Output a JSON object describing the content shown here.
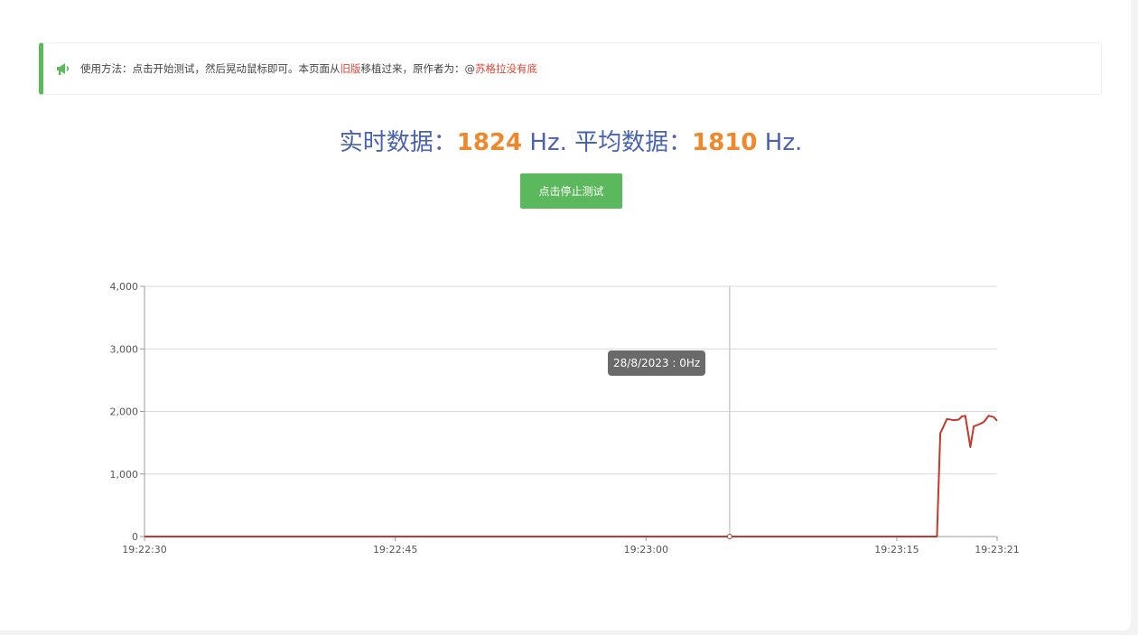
{
  "notice": {
    "icon": "megaphone-icon",
    "prefix": "使用方法：点击开始测试，然后晃动鼠标即可。本页面从",
    "link_old": "旧版",
    "middle": "移植过来，原作者为：@",
    "author": "苏格拉没有底",
    "accent_color": "#5cb85c",
    "link_color": "#e24333"
  },
  "stats": {
    "realtime_label": "实时数据：",
    "realtime_value": "1824",
    "realtime_unit": "Hz.",
    "average_label": "平均数据：",
    "average_value": "1810",
    "average_unit": "Hz."
  },
  "stop_button": {
    "label": "点击停止测试"
  },
  "tooltip": {
    "text": "28/8/2023 : 0Hz"
  },
  "chart_data": {
    "type": "line",
    "title": "",
    "xlabel": "",
    "ylabel": "",
    "ylim": [
      0,
      4000
    ],
    "y_ticks": [
      "0",
      "1,000",
      "2,000",
      "3,000",
      "4,000"
    ],
    "x_ticks": [
      "19:22:30",
      "19:22:45",
      "19:23:00",
      "19:23:15",
      "19:23:21"
    ],
    "grid": true,
    "line_color": "#c0392b",
    "crosshair_x": "19:23:05",
    "series": [
      {
        "x": [
          "19:22:30",
          "19:23:17.4",
          "19:23:17.6",
          "19:23:18.0",
          "19:23:18.4",
          "19:23:18.7",
          "19:23:18.9",
          "19:23:19.1",
          "19:23:19.4",
          "19:23:19.6",
          "19:23:19.9",
          "19:23:20.2",
          "19:23:20.5",
          "19:23:20.8",
          "19:23:21"
        ],
        "values": [
          0,
          0,
          1650,
          1880,
          1860,
          1870,
          1920,
          1930,
          1430,
          1760,
          1790,
          1830,
          1930,
          1910,
          1850
        ]
      }
    ]
  }
}
